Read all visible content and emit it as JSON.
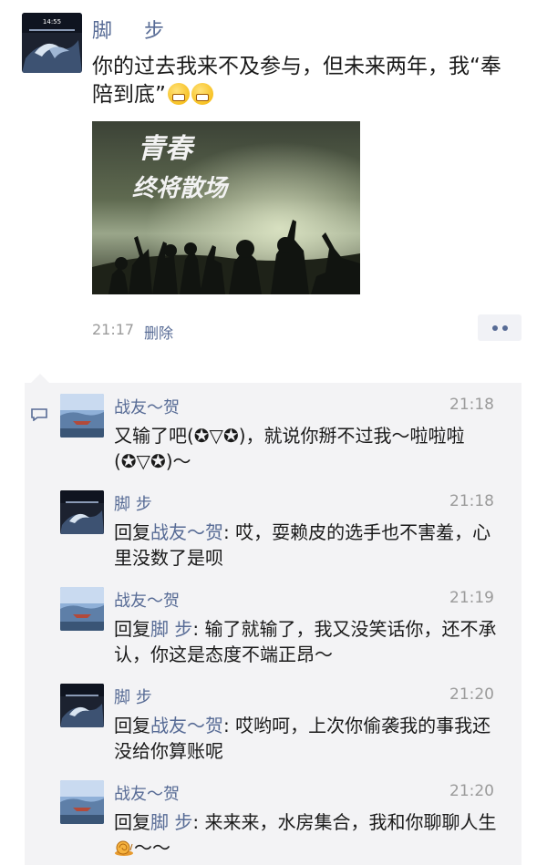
{
  "post": {
    "author": "脚 步",
    "text": "你的过去我来不及参与，但未来两年，我“奉陪到底”",
    "emoji_icons": [
      "grimace-emoji-icon",
      "grimace-emoji-icon"
    ],
    "image": {
      "caption_line1": "青春",
      "caption_line2": "终将散场"
    },
    "time": "21:17",
    "delete_label": "删除",
    "more_icon": "more-dots-icon"
  },
  "comments": [
    {
      "author": "战友～贺",
      "time": "21:18",
      "reply_prefix": "",
      "reply_to": "",
      "text": "又输了吧(✪▽✪)，就说你掰不过我～啦啦啦(✪▽✪)～",
      "avatar": "lake-avatar"
    },
    {
      "author": "脚 步",
      "time": "21:18",
      "reply_prefix": "回复",
      "reply_to": "战友～贺",
      "text": ": 哎，耍赖皮的选手也不害羞，心里没数了是呗",
      "avatar": "phone-avatar"
    },
    {
      "author": "战友～贺",
      "time": "21:19",
      "reply_prefix": "回复",
      "reply_to": "脚 步",
      "text": ": 输了就输了，我又没笑话你，还不承认，你这是态度不端正昂～",
      "avatar": "lake-avatar"
    },
    {
      "author": "脚 步",
      "time": "21:20",
      "reply_prefix": "回复",
      "reply_to": "战友～贺",
      "text": ": 哎哟呵，上次你偷袭我的事我还没给你算账呢",
      "avatar": "phone-avatar"
    },
    {
      "author": "战友～贺",
      "time": "21:20",
      "reply_prefix": "回复",
      "reply_to": "脚 步",
      "text": ": 来来来，水房集合，我和你聊聊人生",
      "text_suffix": "～～",
      "avatar": "lake-avatar",
      "trailing_icon": "snail-emoji-icon"
    }
  ],
  "colors": {
    "link": "#576b95",
    "text": "#1a1a1a",
    "meta": "#9b9b9b",
    "comment_bg": "#f3f3f5"
  }
}
